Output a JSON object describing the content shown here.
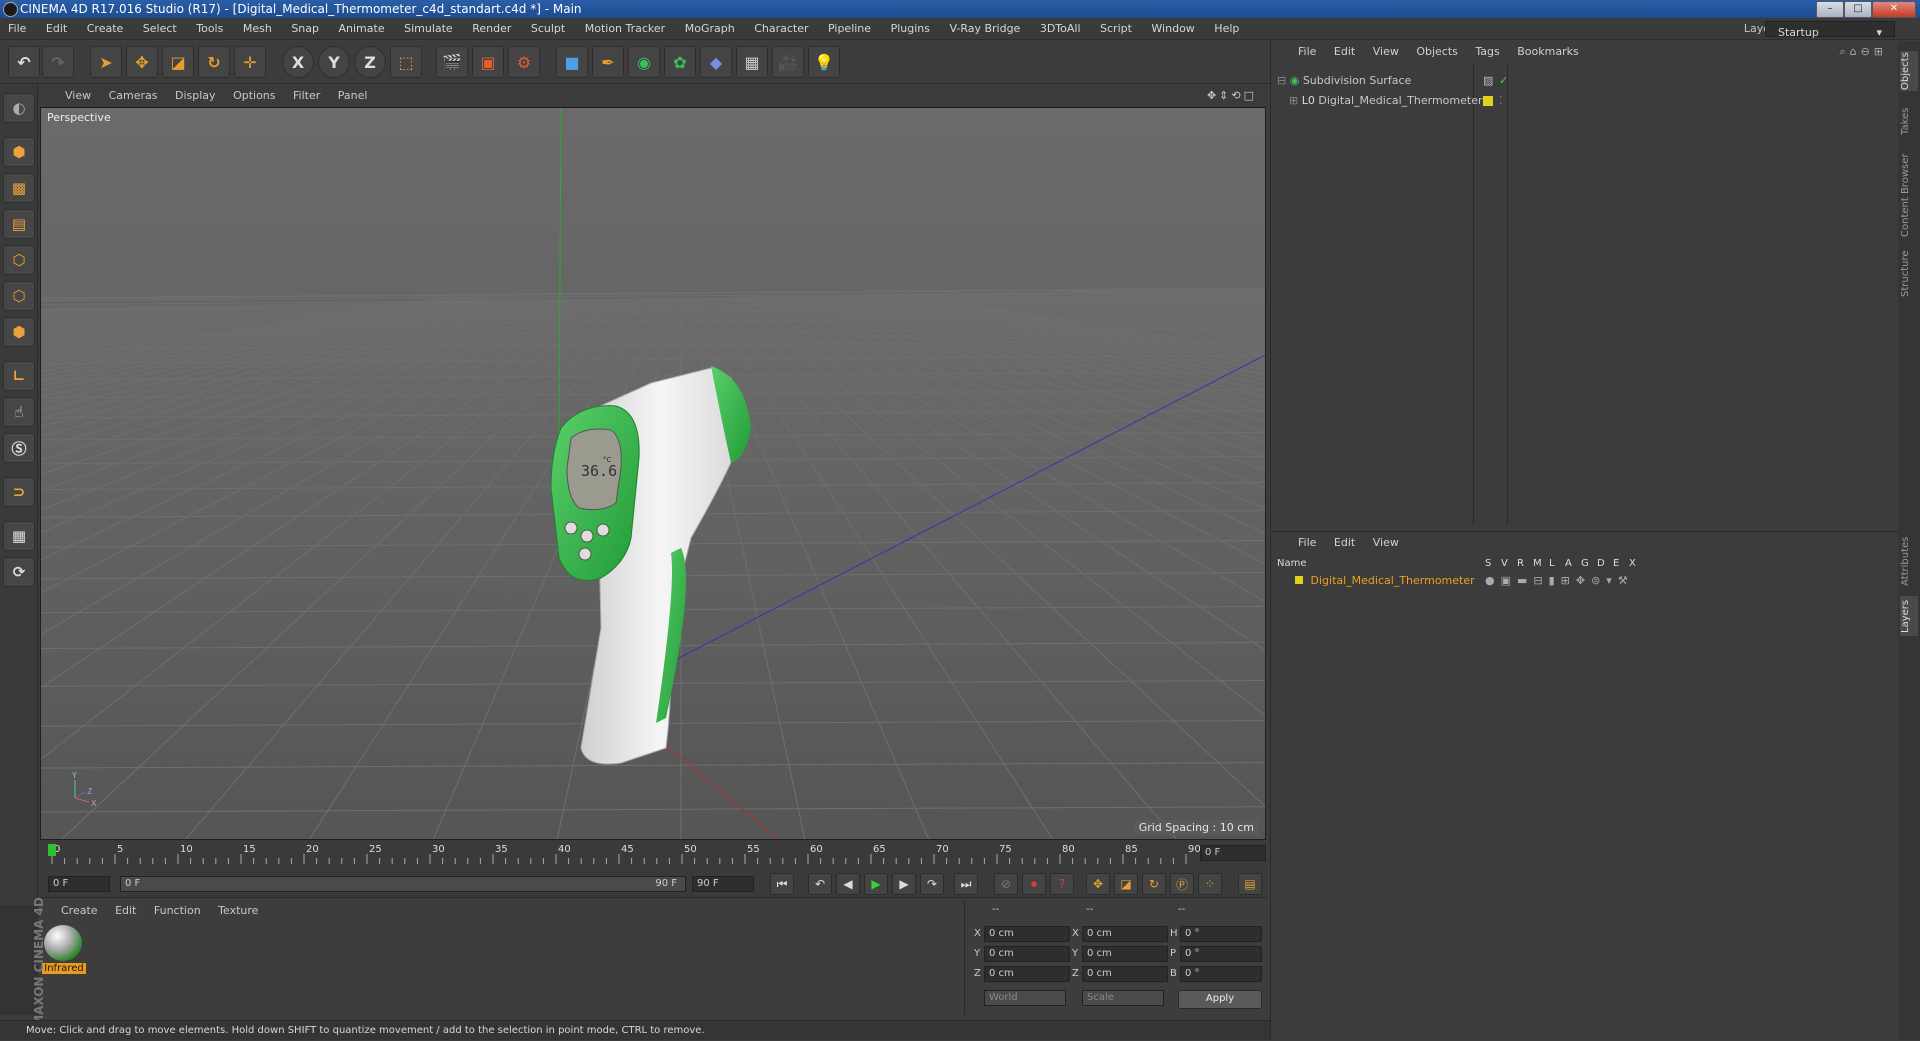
{
  "window": {
    "title": "CINEMA 4D R17.016 Studio (R17) - [Digital_Medical_Thermometer_c4d_standart.c4d *] - Main",
    "buttons": {
      "minimize": "–",
      "maximize": "□",
      "close": "✕"
    }
  },
  "menubar": {
    "items": [
      "File",
      "Edit",
      "Create",
      "Select",
      "Tools",
      "Mesh",
      "Snap",
      "Animate",
      "Simulate",
      "Render",
      "Sculpt",
      "Motion Tracker",
      "MoGraph",
      "Character",
      "Pipeline",
      "Plugins",
      "V-Ray Bridge",
      "3DToAll",
      "Script",
      "Window",
      "Help"
    ],
    "layout_label": "Layout:",
    "layout_value": "Startup"
  },
  "toolbar": {
    "icons": [
      "undo-icon",
      "redo-icon",
      "select-icon",
      "move-icon",
      "scale-icon",
      "rotate-icon",
      "live-select-icon",
      "x-axis-icon",
      "y-axis-icon",
      "z-axis-icon",
      "coord-system-icon",
      "render-view-icon",
      "render-picture-queue-icon",
      "render-settings-icon",
      "cube-icon",
      "spline-pen-icon",
      "subdivision-icon",
      "array-icon",
      "deformer-icon",
      "floor-icon",
      "camera-icon",
      "light-icon"
    ],
    "axis_labels": [
      "X",
      "Y",
      "Z"
    ]
  },
  "left_tools": {
    "icons": [
      "make-editable-icon",
      "model-mode-icon",
      "texture-mode-icon",
      "workplane-icon",
      "points-mode-icon",
      "edges-mode-icon",
      "polygons-mode-icon",
      "axis-mode-icon",
      "tweak-icon",
      "solo-icon",
      "magnet-icon",
      "snap-grid-icon",
      "snap-rotate-icon"
    ]
  },
  "viewport": {
    "menu": [
      "View",
      "Cameras",
      "Display",
      "Options",
      "Filter",
      "Panel"
    ],
    "label": "Perspective",
    "grid_spacing": "Grid Spacing : 10 cm",
    "display_reading": "36.6",
    "display_unit": "°C"
  },
  "timeline": {
    "ticks": [
      "0",
      "5",
      "10",
      "15",
      "20",
      "25",
      "30",
      "35",
      "40",
      "45",
      "50",
      "55",
      "60",
      "65",
      "70",
      "75",
      "80",
      "85",
      "90"
    ],
    "current_frame": "0 F"
  },
  "transport": {
    "start": "0 F",
    "range_start": "0 F",
    "range_end": "90 F",
    "end": "90 F"
  },
  "materials": {
    "menu": [
      "Create",
      "Edit",
      "Function",
      "Texture"
    ],
    "items": [
      {
        "name": "Infrared"
      }
    ]
  },
  "coordinates": {
    "headers": [
      "--",
      "--",
      "--"
    ],
    "rows": [
      {
        "a": "X",
        "av": "0 cm",
        "b": "X",
        "bv": "0 cm",
        "c": "H",
        "cv": "0 °"
      },
      {
        "a": "Y",
        "av": "0 cm",
        "b": "Y",
        "bv": "0 cm",
        "c": "P",
        "cv": "0 °"
      },
      {
        "a": "Z",
        "av": "0 cm",
        "b": "Z",
        "bv": "0 cm",
        "c": "B",
        "cv": "0 °"
      }
    ],
    "mode1": "World",
    "mode2": "Scale",
    "apply": "Apply"
  },
  "objects": {
    "menu": [
      "File",
      "Edit",
      "View",
      "Objects",
      "Tags",
      "Bookmarks"
    ],
    "items": [
      {
        "name": "Subdivision Surface",
        "color": "#c8c8c8"
      },
      {
        "name": "Digital_Medical_Thermometer",
        "color": "#c8c8c8"
      }
    ]
  },
  "layers": {
    "menu": [
      "File",
      "Edit",
      "View"
    ],
    "columns": [
      "Name",
      "S",
      "V",
      "R",
      "M",
      "L",
      "A",
      "G",
      "D",
      "E",
      "X"
    ],
    "items": [
      {
        "name": "Digital_Medical_Thermometer",
        "color": "#e9a21c"
      }
    ]
  },
  "side_tabs": [
    "Objects",
    "Takes",
    "Content Browser",
    "Structure",
    "Attributes",
    "Layers"
  ],
  "branding": "MAXON CINEMA 4D",
  "status": "Move: Click and drag to move elements. Hold down SHIFT to quantize movement / add to the selection in point mode, CTRL to remove.",
  "colors": {
    "accent": "#e9a21c",
    "thermometer_green": "#39b54a",
    "body_white": "#f0f0f0"
  }
}
